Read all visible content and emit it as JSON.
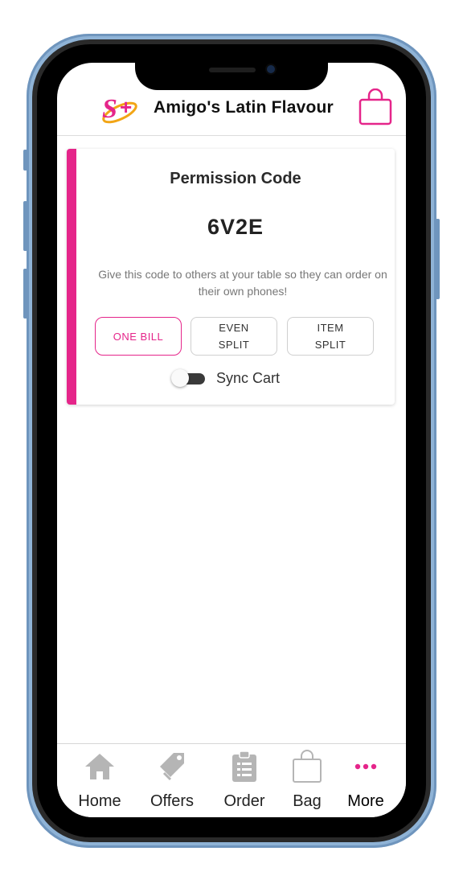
{
  "header": {
    "title": "Amigo's Latin Flavour",
    "logo_text": "S+"
  },
  "permission": {
    "title": "Permission Code",
    "code": "6V2E",
    "description": "Give this code to others at your table so they can order on their own phones!"
  },
  "split_options": [
    {
      "line1": "ONE BILL",
      "line2": "",
      "active": true
    },
    {
      "line1": "EVEN",
      "line2": "SPLIT",
      "active": false
    },
    {
      "line1": "ITEM",
      "line2": "SPLIT",
      "active": false
    }
  ],
  "sync": {
    "label": "Sync Cart",
    "enabled": false
  },
  "nav": {
    "items": [
      {
        "label": "Home",
        "icon": "home-icon"
      },
      {
        "label": "Offers",
        "icon": "tag-icon"
      },
      {
        "label": "Order",
        "icon": "clipboard-icon"
      },
      {
        "label": "Bag",
        "icon": "bag-icon"
      },
      {
        "label": "More",
        "icon": "more-dots-icon"
      }
    ]
  },
  "colors": {
    "accent": "#e5258a",
    "nav_icon": "#b5b5b5",
    "frame": "#8fb3d6"
  }
}
